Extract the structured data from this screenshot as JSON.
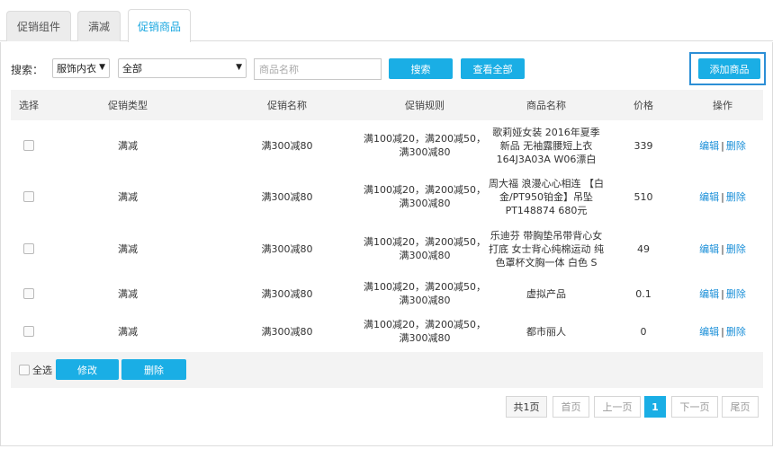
{
  "tabs": [
    {
      "label": "促销组件"
    },
    {
      "label": "满减"
    },
    {
      "label": "促销商品"
    }
  ],
  "search": {
    "label": "搜索：",
    "category": "服饰内衣",
    "type": "全部",
    "placeholder": "商品名称",
    "search_button": "搜索",
    "view_all_button": "查看全部",
    "add_button": "添加商品"
  },
  "table": {
    "headers": [
      "选择",
      "促销类型",
      "促销名称",
      "促销规则",
      "商品名称",
      "价格",
      "操作"
    ],
    "edit_label": "编辑",
    "delete_label": "删除",
    "separator": "|",
    "rows": [
      {
        "type": "满减",
        "name": "满300减80",
        "rule": "满100减20，满200减50，满300减80",
        "product": "歌莉娅女装 2016年夏季新品 无袖露腰短上衣 164J3A03A W06漂白",
        "price": "339"
      },
      {
        "type": "满减",
        "name": "满300减80",
        "rule": "满100减20，满200减50，满300减80",
        "product": "周大福 浪漫心心相连 【白金/PT950铂金】吊坠 PT148874 680元",
        "price": "510"
      },
      {
        "type": "满减",
        "name": "满300减80",
        "rule": "满100减20，满200减50，满300减80",
        "product": "乐迪芬 带胸垫吊带背心女打底 女士背心纯棉运动 纯色罩杯文胸一体 白色 S",
        "price": "49"
      },
      {
        "type": "满减",
        "name": "满300减80",
        "rule": "满100减20，满200减50，满300减80",
        "product": "虚拟产品",
        "price": "0.1"
      },
      {
        "type": "满减",
        "name": "满300减80",
        "rule": "满100减20，满200减50，满300减80",
        "product": "都市丽人",
        "price": "0"
      }
    ]
  },
  "footer": {
    "select_all": "全选",
    "edit_button": "修改",
    "delete_button": "删除"
  },
  "pagination": {
    "total": "共1页",
    "first": "首页",
    "prev": "上一页",
    "current": "1",
    "next": "下一页",
    "last": "尾页"
  }
}
